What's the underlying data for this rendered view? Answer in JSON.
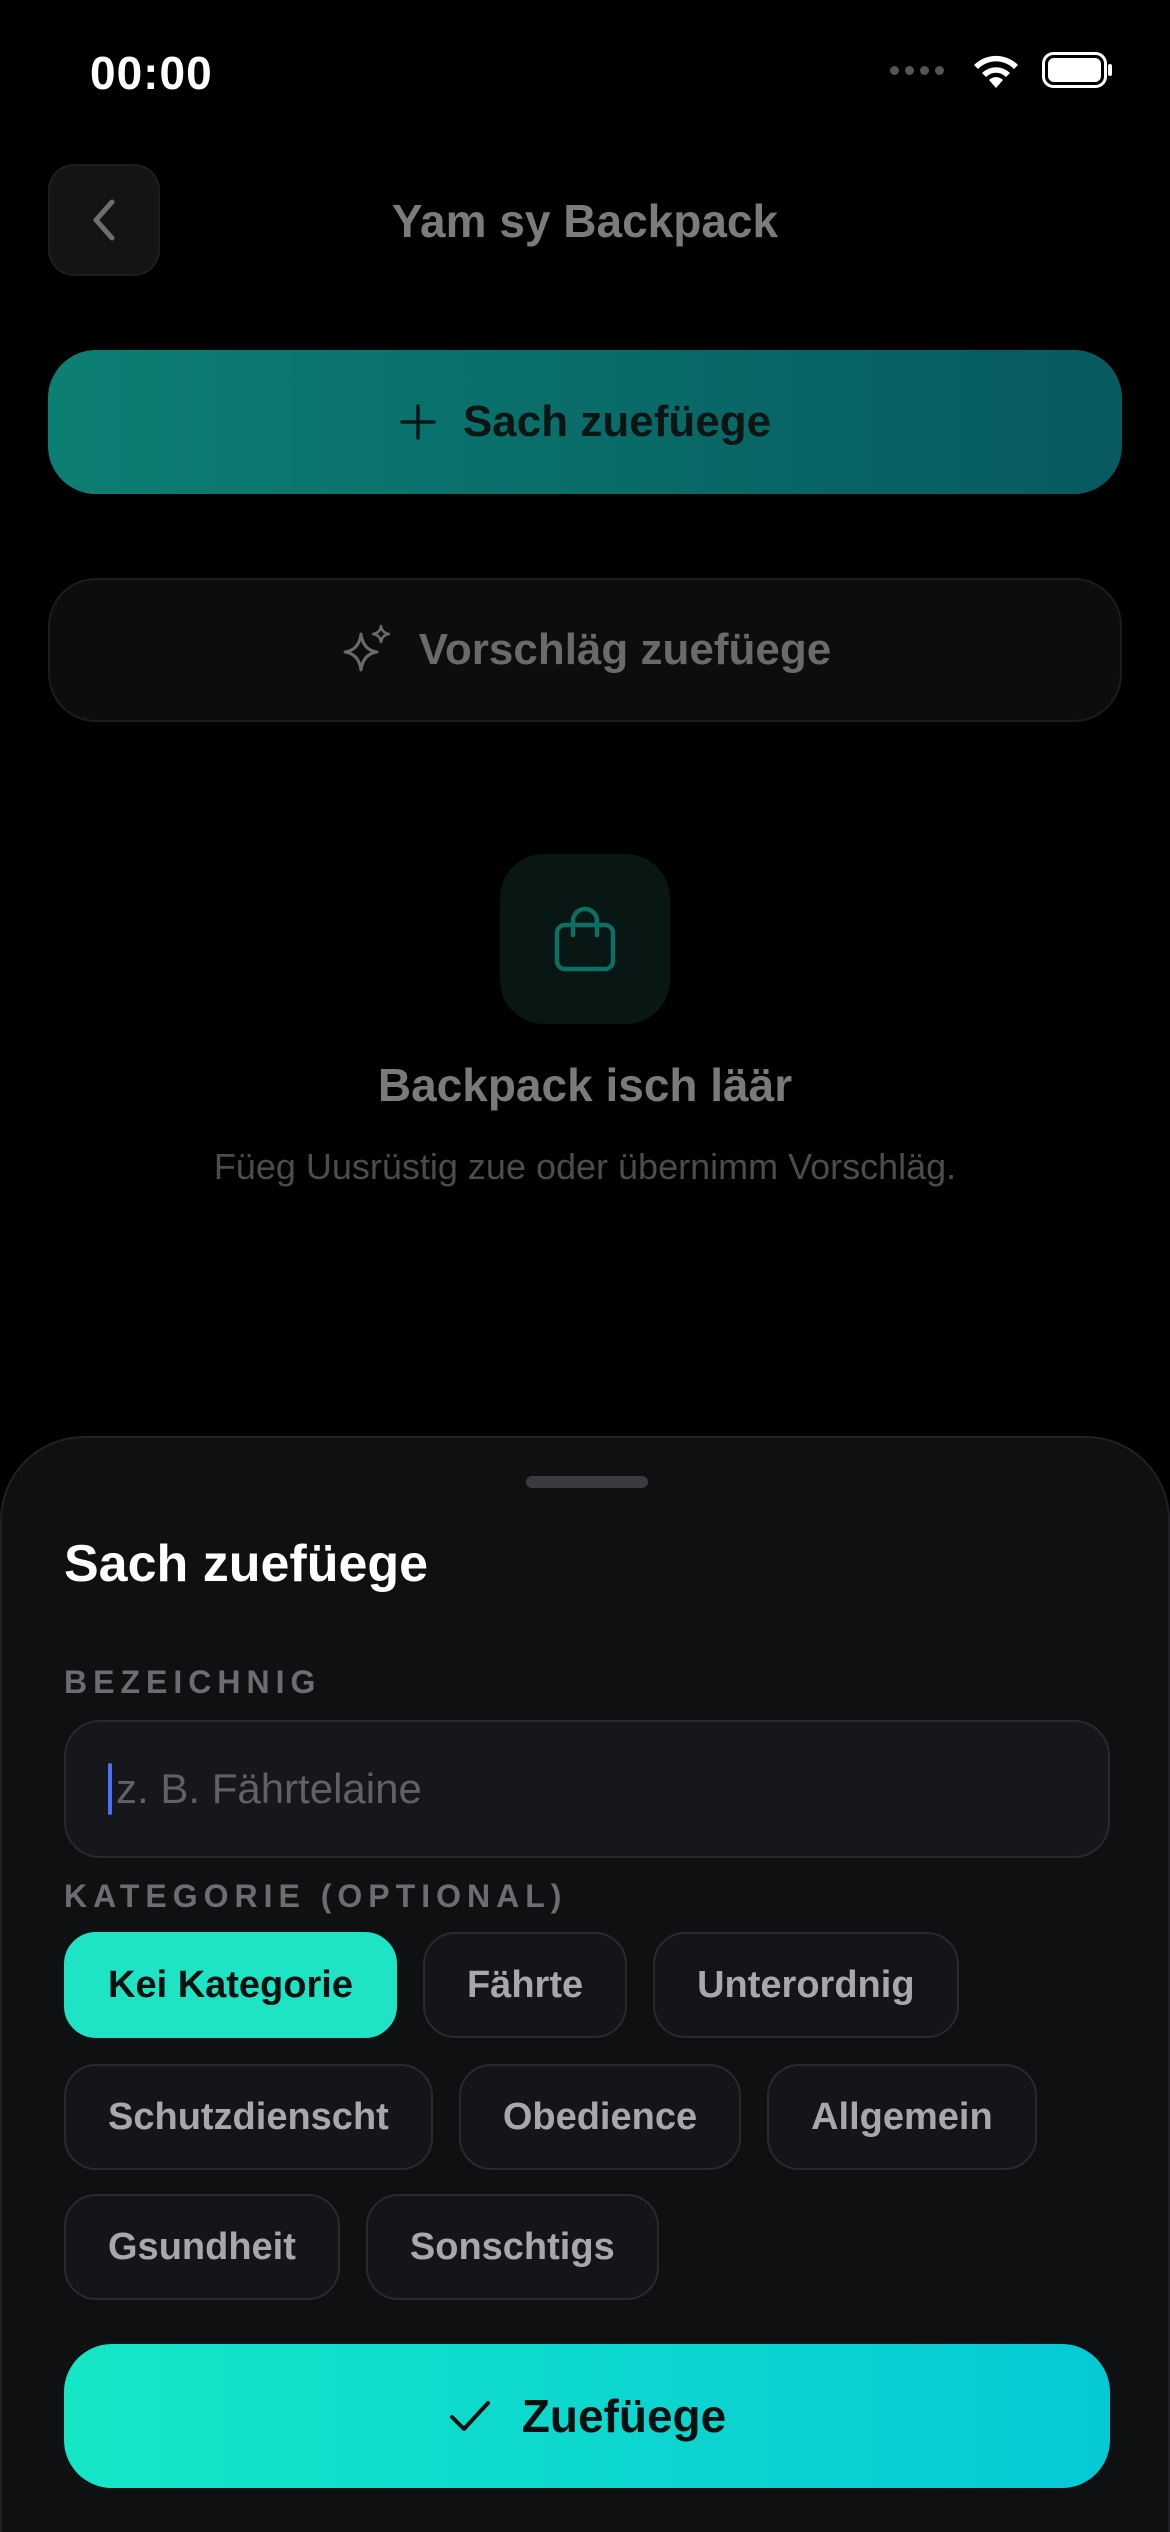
{
  "status_bar": {
    "time": "00:00"
  },
  "header": {
    "title": "Yam sy Backpack"
  },
  "actions": {
    "add_item_label": "Sach zuefüege",
    "suggestions_label": "Vorschläg zuefüege"
  },
  "empty_state": {
    "title": "Backpack isch läär",
    "subtitle": "Füeg Uusrüstig zue oder übernimm Vorschläg."
  },
  "sheet": {
    "title": "Sach zuefüege",
    "name_label": "BEZEICHNIG",
    "name_placeholder": "z. B. Fährtelaine",
    "name_value": "",
    "category_label": "KATEGORIE (OPTIONAL)",
    "categories": [
      {
        "label": "Kei Kategorie",
        "selected": true
      },
      {
        "label": "Fährte",
        "selected": false
      },
      {
        "label": "Unterordnig",
        "selected": false
      },
      {
        "label": "Schutzdienscht",
        "selected": false
      },
      {
        "label": "Obedience",
        "selected": false
      },
      {
        "label": "Allgemein",
        "selected": false
      },
      {
        "label": "Gsundheit",
        "selected": false
      },
      {
        "label": "Sonschtigs",
        "selected": false
      }
    ],
    "submit_label": "Zuefüege"
  },
  "colors": {
    "accent": "#1ee3c4",
    "accent_gradient_end": "#05c9d6",
    "background": "#000000",
    "sheet_background": "#0f1012"
  }
}
